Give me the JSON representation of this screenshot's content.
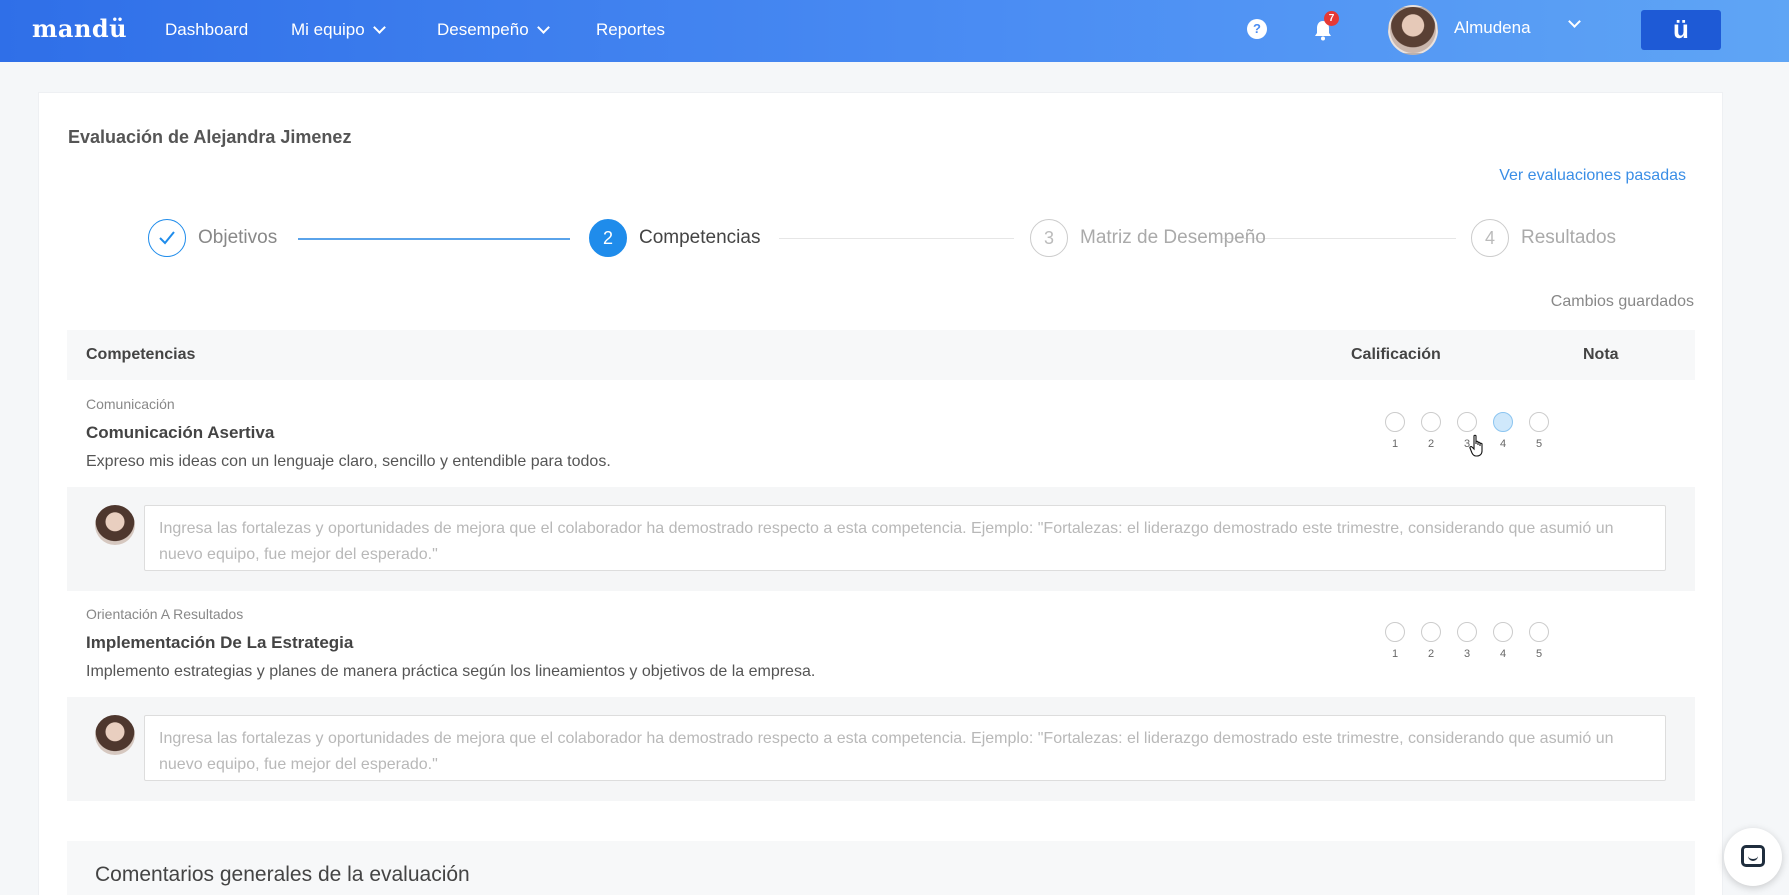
{
  "nav": {
    "logo": "mandü",
    "items": [
      {
        "label": "Dashboard"
      },
      {
        "label": "Mi equipo"
      },
      {
        "label": "Desempeño"
      },
      {
        "label": "Reportes"
      }
    ],
    "help": "?",
    "notifications_count": "7",
    "user_name": "Almudena",
    "brand_button": "ü"
  },
  "evaluation": {
    "title": "Evaluación de Alejandra Jimenez",
    "past_link": "Ver evaluaciones pasadas",
    "saved_status": "Cambios guardados"
  },
  "steps": [
    {
      "number": "1",
      "label": "Objetivos",
      "state": "done"
    },
    {
      "number": "2",
      "label": "Competencias",
      "state": "active"
    },
    {
      "number": "3",
      "label": "Matriz de Desempeño",
      "state": "todo"
    },
    {
      "number": "4",
      "label": "Resultados",
      "state": "todo"
    }
  ],
  "table": {
    "col_competencias": "Competencias",
    "col_calificacion": "Calificación",
    "col_nota": "Nota",
    "rating_labels": [
      "1",
      "2",
      "3",
      "4",
      "5"
    ],
    "rows": [
      {
        "category": "Comunicación",
        "name": "Comunicación Asertiva",
        "description": "Expreso mis ideas con un lenguaje claro, sencillo y entendible para todos.",
        "note_placeholder": "Ingresa las fortalezas y oportunidades de mejora que el colaborador ha demostrado respecto a esta competencia. Ejemplo: \"Fortalezas: el liderazgo demostrado este trimestre, considerando que asumió un nuevo equipo, fue mejor del esperado.\""
      },
      {
        "category": "Orientación A Resultados",
        "name": "Implementación De La Estrategia",
        "description": "Implemento estrategias y planes de manera práctica según los lineamientos y objetivos de la empresa.",
        "note_placeholder": "Ingresa las fortalezas y oportunidades de mejora que el colaborador ha demostrado respecto a esta competencia. Ejemplo: \"Fortalezas: el liderazgo demostrado este trimestre, considerando que asumió un nuevo equipo, fue mejor del esperado.\""
      }
    ]
  },
  "general_comments_title": "Comentarios generales de la evaluación"
}
